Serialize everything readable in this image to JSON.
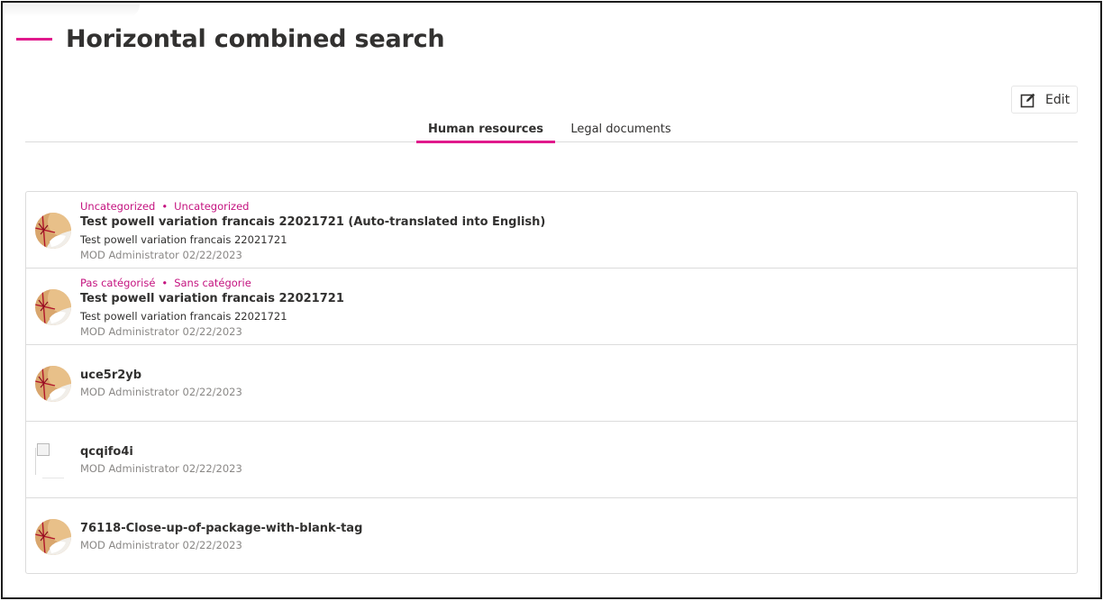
{
  "page": {
    "title": "Horizontal combined search",
    "accent_color": "#e0198c"
  },
  "toolbar": {
    "edit_icon": "edit-icon",
    "edit_label": "Edit"
  },
  "tabs": [
    {
      "label": "Human resources",
      "active": true
    },
    {
      "label": "Legal documents",
      "active": false
    }
  ],
  "results": [
    {
      "thumbnail": "package-with-tag-image",
      "categories": [
        "Uncategorized",
        "Uncategorized"
      ],
      "title": "Test powell variation francais 22021721 (Auto-translated into English)",
      "description": "Test powell variation francais 22021721",
      "meta": "MOD Administrator 02/22/2023"
    },
    {
      "thumbnail": "package-with-tag-image",
      "categories": [
        "Pas catégorisé",
        "Sans catégorie"
      ],
      "title": "Test powell variation francais 22021721",
      "description": "Test powell variation francais 22021721",
      "meta": "MOD Administrator 02/22/2023"
    },
    {
      "thumbnail": "package-with-tag-image",
      "title": "uce5r2yb",
      "meta": "MOD Administrator 02/22/2023"
    },
    {
      "thumbnail": "broken-image-icon",
      "title": "qcqifo4i",
      "meta": "MOD Administrator 02/22/2023"
    },
    {
      "thumbnail": "package-with-tag-image",
      "title": "76118-Close-up-of-package-with-blank-tag",
      "meta": "MOD Administrator 02/22/2023"
    }
  ],
  "colors": {
    "category_text": "#c4127f",
    "meta_text": "#8a8886",
    "border": "#dcdcdc"
  }
}
